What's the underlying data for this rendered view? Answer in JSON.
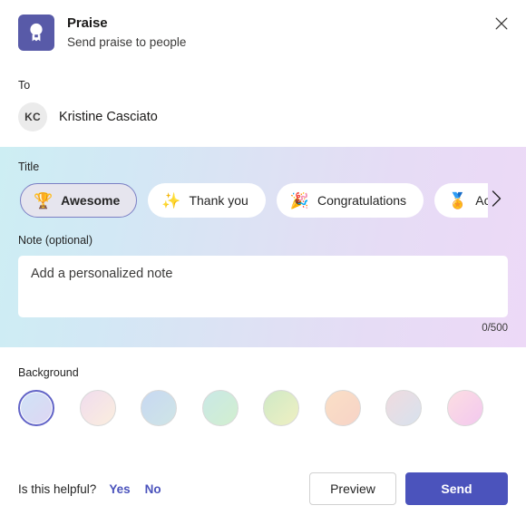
{
  "header": {
    "title": "Praise",
    "subtitle": "Send praise to people",
    "app_icon": "award-badge-icon",
    "close_icon": "close-icon",
    "icon_color": "#585aa8"
  },
  "recipient": {
    "label": "To",
    "avatar_initials": "KC",
    "name": "Kristine Casciato"
  },
  "title_section": {
    "label": "Title",
    "scroll_next_icon": "chevron-right-icon",
    "chips": [
      {
        "label": "Awesome",
        "emoji": "🏆",
        "emoji_name": "trophy-icon",
        "selected": true
      },
      {
        "label": "Thank you",
        "emoji": "✨",
        "emoji_name": "sparkles-icon",
        "selected": false
      },
      {
        "label": "Congratulations",
        "emoji": "🎉",
        "emoji_name": "party-popper-icon",
        "selected": false
      },
      {
        "label": "Achievement",
        "emoji": "🏅",
        "emoji_name": "medal-icon",
        "selected": false
      }
    ]
  },
  "note": {
    "label": "Note (optional)",
    "placeholder": "Add a personalized note",
    "value": "",
    "char_count": "0/500"
  },
  "background": {
    "label": "Background",
    "swatches": [
      {
        "name": "lavender-blue",
        "from": "#cfe3f7",
        "to": "#ded6f2",
        "selected": true
      },
      {
        "name": "pink-cream",
        "from": "#f0dcee",
        "to": "#fbeede",
        "selected": false
      },
      {
        "name": "blue-teal",
        "from": "#c7d8f2",
        "to": "#cfe5e6",
        "selected": false
      },
      {
        "name": "mint-green",
        "from": "#c9e8e6",
        "to": "#d2efcf",
        "selected": false
      },
      {
        "name": "green-yellow",
        "from": "#cfe9c6",
        "to": "#eff0c2",
        "selected": false
      },
      {
        "name": "peach-orange",
        "from": "#fadfc6",
        "to": "#f7d3c6",
        "selected": false
      },
      {
        "name": "rose-gray",
        "from": "#f0dbdf",
        "to": "#d7e2ee",
        "selected": false
      },
      {
        "name": "pink-magenta",
        "from": "#fcdee2",
        "to": "#f3c8ef",
        "selected": false
      }
    ]
  },
  "footer": {
    "helpful_question": "Is this helpful?",
    "yes_label": "Yes",
    "no_label": "No",
    "preview_label": "Preview",
    "send_label": "Send",
    "accent_color": "#4b53bc"
  }
}
